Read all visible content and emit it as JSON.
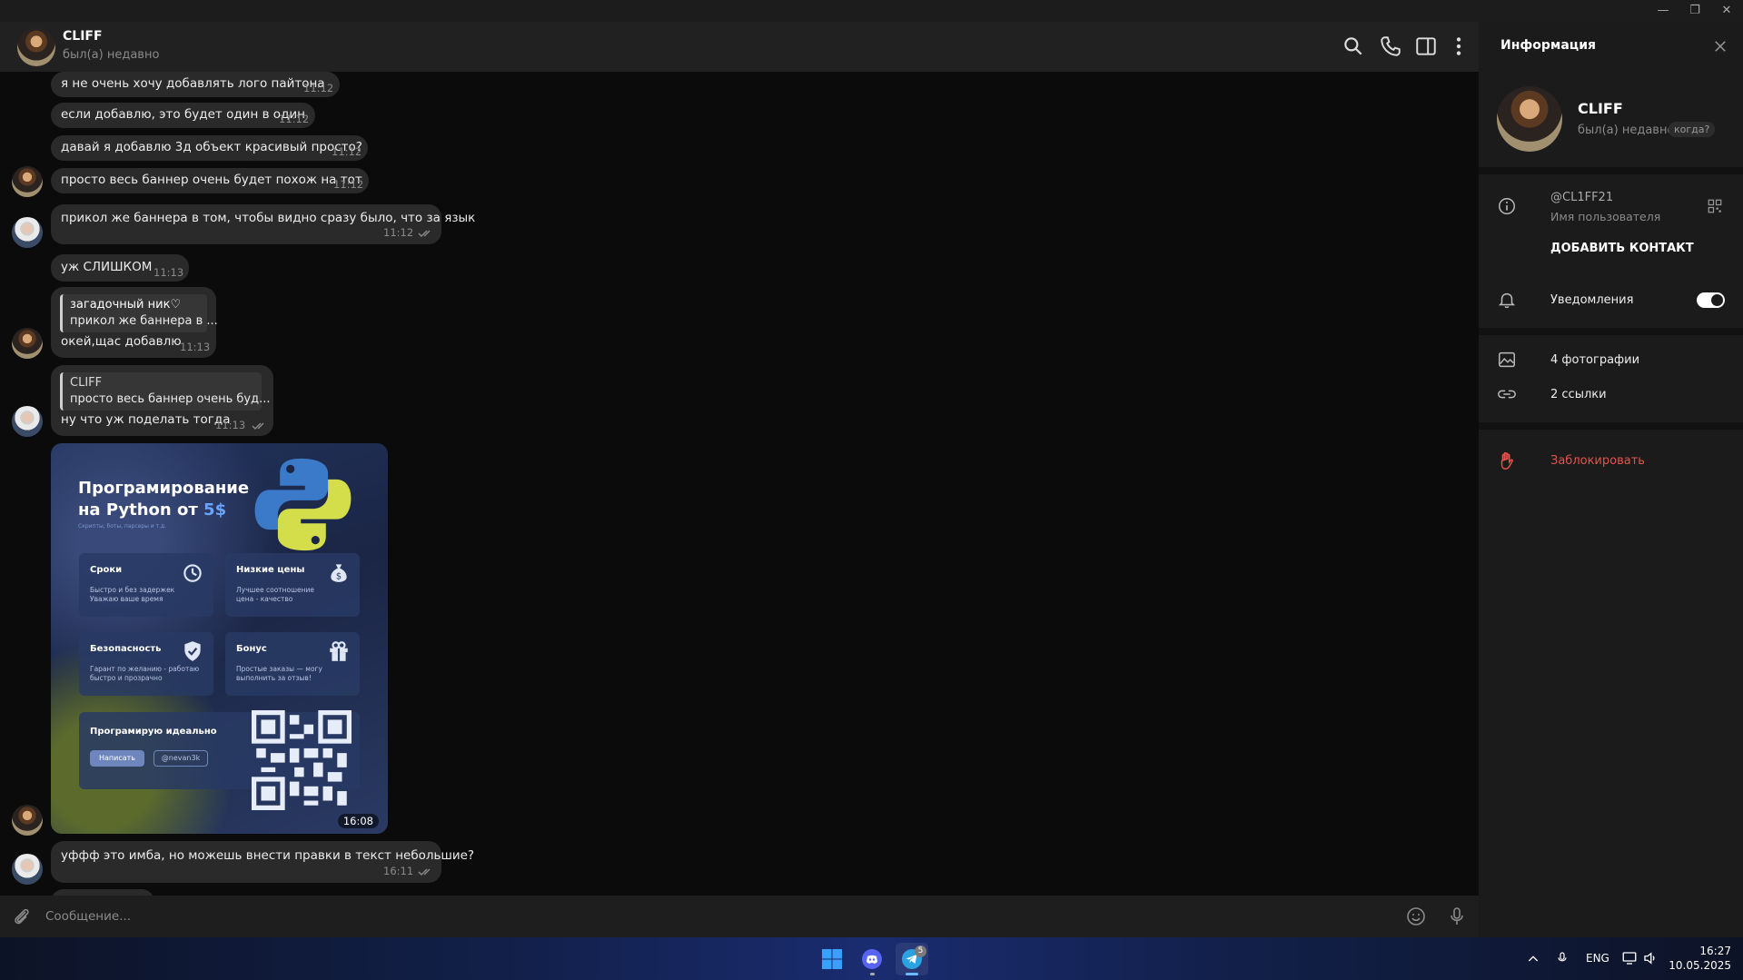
{
  "window": {
    "minimize": "—",
    "restore": "❐",
    "close": "✕"
  },
  "header": {
    "name": "CLIFF",
    "status": "был(а) недавно"
  },
  "messages": [
    {
      "text": "я не очень хочу добавлять лого пайтона",
      "time": "11:12"
    },
    {
      "text": "если добавлю, это будет один в один",
      "time": "11:12"
    },
    {
      "text": "давай я добавлю 3д объект красивый просто?",
      "time": "11:12"
    },
    {
      "text": "просто весь баннер очень будет похож на тот",
      "time": "11:12"
    },
    {
      "text": "прикол же баннера в том, чтобы видно сразу было, что за язык",
      "time": "11:12"
    },
    {
      "text": "уж СЛИШКОМ",
      "time": "11:13"
    },
    {
      "reply_author": "загадочный ник♡",
      "reply_text": "прикол же баннера в ...",
      "text": "окей,щас добавлю",
      "time": "11:13"
    },
    {
      "reply_author": "CLIFF",
      "reply_text": "просто весь баннер очень буд...",
      "text": "ну что уж поделать тогда",
      "time": "11:13"
    },
    {
      "text": "уффф это имба, но можешь внести правки в текст небольшие?",
      "time": "16:11"
    }
  ],
  "banner": {
    "title_line1": "Програмирование",
    "title_line2": "на Python от ",
    "price": "5$",
    "subtitle": "Скрипты, боты, парсеры и т.д.",
    "cards": [
      {
        "title": "Сроки",
        "desc": "Быстро и без задержек\nУважаю ваше время"
      },
      {
        "title": "Низкие цены",
        "desc": "Лучшее соотношение\nцена - качество"
      },
      {
        "title": "Безопасность",
        "desc": "Гарант по желанию - работаю\nбыстро и прозрачно"
      },
      {
        "title": "Бонус",
        "desc": "Простые заказы — могу\nвыполнить за отзыв!"
      }
    ],
    "promo_title": "Програмирую идеально",
    "button_write": "Написать",
    "handle": "@nevan3k",
    "time": "16:08"
  },
  "input": {
    "placeholder": "Сообщение..."
  },
  "info": {
    "title": "Информация",
    "name": "CLIFF",
    "status": "был(а) недавно",
    "when_badge": "когда?",
    "username": "@CL1FF21",
    "username_label": "Имя пользователя",
    "add_contact": "ДОБАВИТЬ КОНТАКТ",
    "notifications": "Уведомления",
    "notifications_on": true,
    "photos": "4 фотографии",
    "links": "2 ссылки",
    "block": "Заблокировать"
  },
  "taskbar": {
    "telegram_badge": "5",
    "lang": "ENG",
    "time": "16:27",
    "date": "10.05.2025"
  },
  "colors": {
    "accent_red": "#e5534b",
    "toggle_on": "#ffffff",
    "bubble": "#2a2a2a"
  }
}
